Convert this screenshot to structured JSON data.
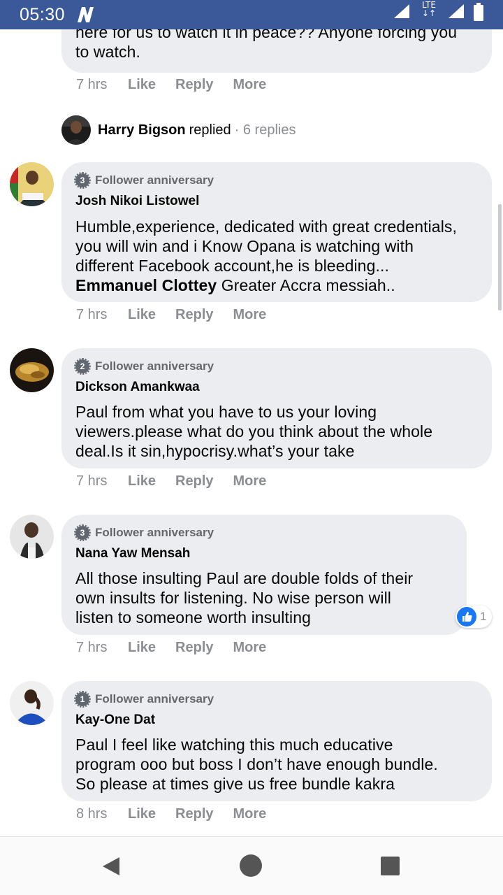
{
  "status_bar": {
    "time": "05:30",
    "network": "LTE"
  },
  "top_comment": {
    "text_line1": "here for us to watch it in peace?? Anyone forcing you",
    "text_line2": "to watch.",
    "time": "7 hrs"
  },
  "actions": {
    "like": "Like",
    "reply": "Reply",
    "more": "More"
  },
  "replied": {
    "name": "Harry Bigson",
    "verb": "replied",
    "count": "· 6 replies"
  },
  "comments": [
    {
      "badge_number": "3",
      "badge_label": "Follower anniversary",
      "author": "Josh Nikoi Listowel",
      "lines": [
        "Humble,experience, dedicated with great credentials,",
        "you will win and i Know Opana is watching with",
        "different Facebook account,he is bleeding..."
      ],
      "mention": "Emmanuel Clottey",
      "mention_tail": " Greater Accra messiah..",
      "time": "7 hrs"
    },
    {
      "badge_number": "2",
      "badge_label": "Follower anniversary",
      "author": "Dickson Amankwaa",
      "lines": [
        "Paul from what you have to us your loving",
        "viewers.please what do you think about the whole",
        "deal.Is it sin,hypocrisy.what’s your take"
      ],
      "time": "7 hrs"
    },
    {
      "badge_number": "3",
      "badge_label": "Follower anniversary",
      "author": "Nana Yaw Mensah",
      "lines": [
        "All those insulting Paul are double folds of their",
        "own insults for listening. No wise person will",
        "listen to someone worth insulting"
      ],
      "time": "7 hrs",
      "reaction_count": "1"
    },
    {
      "badge_number": "1",
      "badge_label": "Follower anniversary",
      "author": "Kay-One Dat",
      "lines": [
        "Paul I feel like watching this much educative",
        "program ooo but boss I don’t have enough bundle.",
        "So please at times give us free bundle kakra"
      ],
      "time": "8 hrs"
    }
  ],
  "colors": {
    "status_bar": "#3b5998",
    "bubble": "#ebedf0",
    "muted": "#8a8d91",
    "like_blue": "#1877f2"
  },
  "icons": [
    "n-logo-icon",
    "signal-icon",
    "battery-icon",
    "like-thumb-icon",
    "back-nav-icon",
    "home-nav-icon",
    "recents-nav-icon"
  ]
}
